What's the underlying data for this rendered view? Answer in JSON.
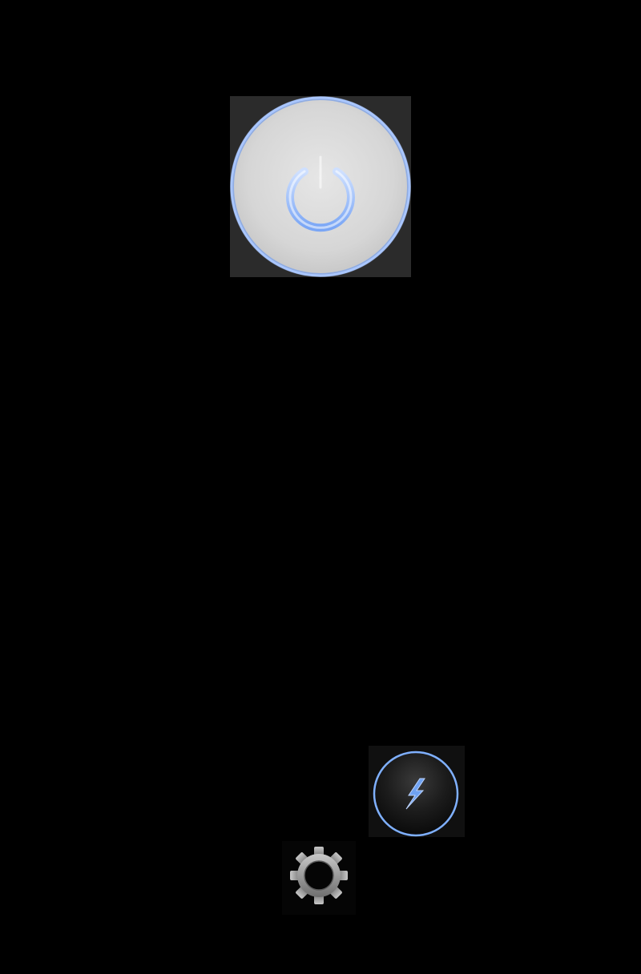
{
  "screen": {
    "background_color": "#000000"
  },
  "power_button": {
    "icon": "power-icon",
    "state": "off",
    "face_color": "#dcdcdc",
    "glow_color": "#8fb4ff"
  },
  "flash_button": {
    "icon": "lightning-bolt-icon",
    "ring_color": "#7fb0ff",
    "bolt_color": "#6fa2f2"
  },
  "settings_button": {
    "icon": "gear-icon",
    "color": "#9a9a9a"
  }
}
